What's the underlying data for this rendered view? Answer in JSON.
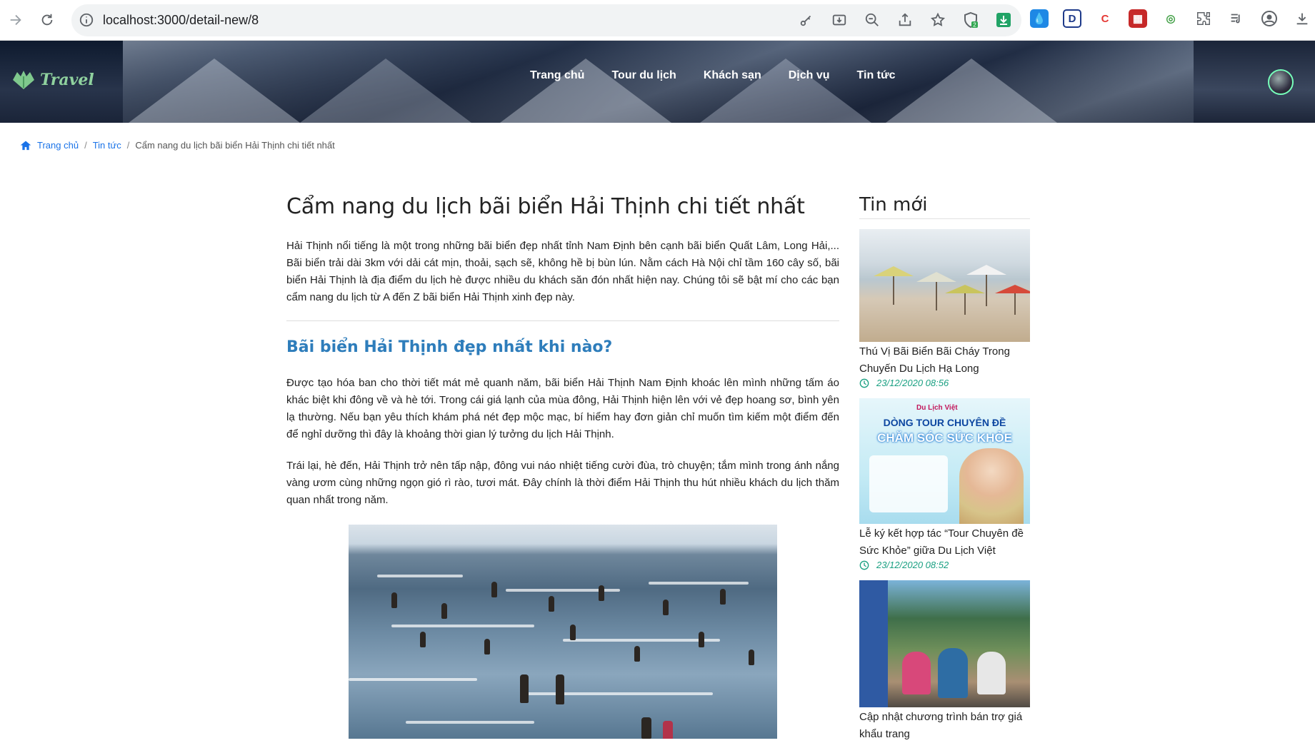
{
  "browser": {
    "url": "localhost:3000/detail-new/8"
  },
  "header": {
    "logo_text": "Travel",
    "nav": [
      "Trang chủ",
      "Tour du lịch",
      "Khách sạn",
      "Dịch vụ",
      "Tin tức"
    ]
  },
  "breadcrumb": {
    "home": "Trang chủ",
    "section": "Tin tức",
    "current": "Cẩm nang du lịch bãi biển Hải Thịnh chi tiết nhất"
  },
  "article": {
    "title": "Cẩm nang du lịch bãi biển Hải Thịnh chi tiết nhất",
    "intro": "Hải Thịnh nổi tiếng là một trong những bãi biển đẹp nhất tỉnh Nam Định bên cạnh bãi biển Quất Lâm, Long Hải,... Bãi biển trải dài 3km với dải cát mịn, thoải, sạch sẽ, không hề bị bùn lún. Nằm cách Hà Nội chỉ tầm 160 cây số, bãi biển Hải Thịnh là địa điểm du lịch hè được nhiều du khách săn đón nhất hiện nay. Chúng tôi sẽ bật mí cho các bạn cẩm nang du lịch từ A đến Z bãi biển Hải Thịnh xinh đẹp này.",
    "section_heading": "Bãi biển Hải Thịnh đẹp nhất khi nào?",
    "paragraph_1": "Được tạo hóa ban cho thời tiết mát mẻ quanh năm, bãi biển Hải Thịnh Nam Định khoác lên mình những tấm áo khác biệt khi đông về và hè tới. Trong cái giá lạnh của mùa đông, Hải Thịnh hiện lên với vẻ đẹp hoang sơ, bình yên lạ thường. Nếu bạn yêu thích khám phá nét đẹp mộc mạc, bí hiểm hay đơn giản chỉ muốn tìm kiếm một điểm đến để nghỉ dưỡng thì đây là khoảng thời gian lý tưởng du lịch Hải Thịnh.",
    "paragraph_2": "Trái lại, hè đến, Hải Thịnh trở nên tấp nập, đông vui náo nhiệt tiếng cười đùa, trò chuyện; tắm mình trong ánh nắng vàng ươm cùng những ngọn gió rì rào, tươi mát. Đây chính là thời điểm Hải Thịnh thu hút nhiều khách du lịch thăm quan nhất trong năm."
  },
  "sidebar": {
    "heading": "Tin mới",
    "items": [
      {
        "title": "Thú Vị Bãi Biển Bãi Cháy Trong Chuyến Du Lịch Hạ Long",
        "date": "23/12/2020 08:56"
      },
      {
        "title": "Lễ ký kết hợp tác “Tour Chuyên đề Sức Khỏe” giữa Du Lịch Việt",
        "date": "23/12/2020 08:52",
        "banner_brand": "Du Lịch Việt",
        "banner_line1": "DÒNG TOUR CHUYÊN ĐỀ",
        "banner_line2": "CHĂM SÓC SỨC KHỎE"
      },
      {
        "title": "Cập nhật chương trình bán trợ giá khẩu trang",
        "date": ""
      }
    ]
  },
  "colors": {
    "link": "#1a73e8",
    "heading_blue": "#2e7dbb",
    "date_green": "#1aa082"
  }
}
